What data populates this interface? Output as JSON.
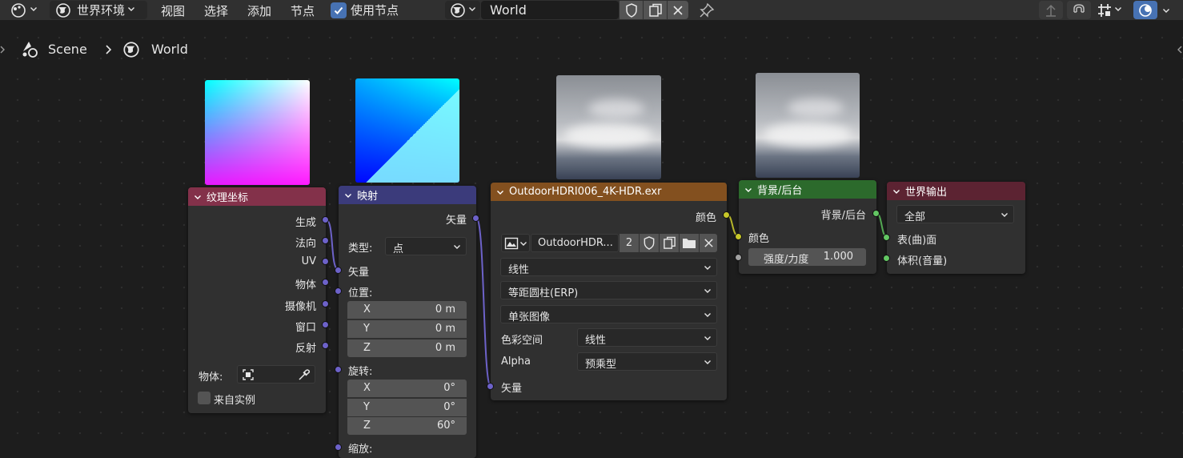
{
  "header": {
    "editor_type_icon": "shader-editor-icon",
    "shader_type": "世界环境",
    "menus": [
      "视图",
      "选择",
      "添加",
      "节点"
    ],
    "use_nodes_label": "使用节点",
    "use_nodes_checked": true,
    "world_name": "World",
    "icons": [
      "world-icon",
      "fake-user-shield-icon",
      "duplicate-icon",
      "close-icon",
      "pin-icon",
      "parent-up-icon",
      "snap-magnet-icon",
      "snap-grid-icon",
      "overlay-icon"
    ]
  },
  "breadcrumb": {
    "scene": "Scene",
    "world": "World"
  },
  "nodes": {
    "tex_coord": {
      "title": "纹理坐标",
      "header_color": "#83314a",
      "outputs": [
        "生成",
        "法向",
        "UV",
        "物体",
        "摄像机",
        "窗口",
        "反射"
      ],
      "object_label": "物体:",
      "from_instancer_label": "来自实例",
      "from_instancer_checked": false
    },
    "mapping": {
      "title": "映射",
      "header_color": "#3b3b7b",
      "output": "矢量",
      "type_label": "类型:",
      "type_value": "点",
      "vector_input": "矢量",
      "location_label": "位置:",
      "location": [
        {
          "axis": "X",
          "value": "0 m"
        },
        {
          "axis": "Y",
          "value": "0 m"
        },
        {
          "axis": "Z",
          "value": "0 m"
        }
      ],
      "rotation_label": "旋转:",
      "rotation": [
        {
          "axis": "X",
          "value": "0°"
        },
        {
          "axis": "Y",
          "value": "0°"
        },
        {
          "axis": "Z",
          "value": "60°"
        }
      ],
      "scale_label": "缩放:"
    },
    "env_texture": {
      "title": "OutdoorHDRI006_4K-HDR.exr",
      "header_color": "#83501f",
      "output": "颜色",
      "image_name": "OutdoorHDR...",
      "users_count": "2",
      "interpolation": "线性",
      "projection": "等距圆柱(ERP)",
      "source": "单张图像",
      "colorspace_label": "色彩空间",
      "colorspace_value": "线性",
      "alpha_label": "Alpha",
      "alpha_value": "预乘型",
      "vector_input": "矢量"
    },
    "background": {
      "title": "背景/后台",
      "header_color": "#2c6a2c",
      "output": "背景/后台",
      "color_input": "颜色",
      "strength_label": "强度/力度",
      "strength_value": "1.000"
    },
    "world_output": {
      "title": "世界输出",
      "header_color": "#5c2332",
      "target": "全部",
      "surface_input": "表(曲)面",
      "volume_input": "体积(音量)"
    }
  },
  "colors": {
    "accent_blue": "#4772b3",
    "socket_vector": "#6d62c9",
    "socket_color": "#c7c729",
    "socket_shader": "#63c763",
    "socket_float": "#a1a1a1"
  }
}
